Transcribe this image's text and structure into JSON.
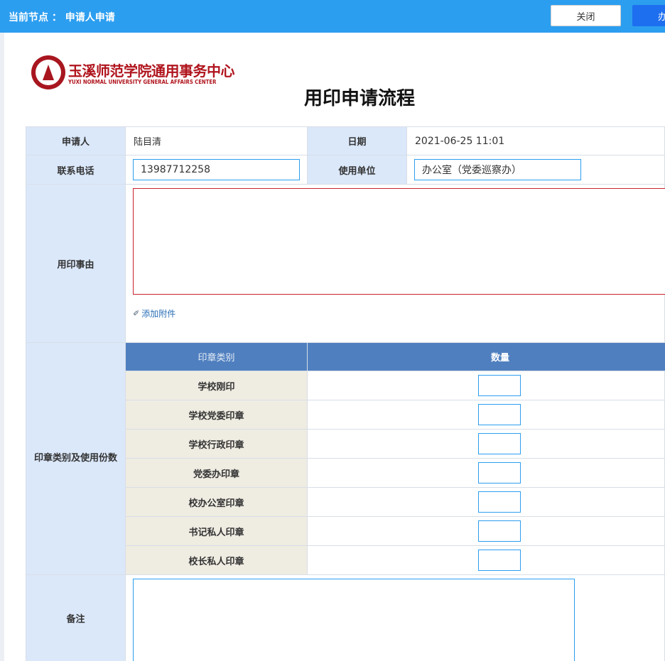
{
  "header": {
    "node_text": "当前节点 ： 申请人申请",
    "close_label": "关闭",
    "submit_label": "办理"
  },
  "logo": {
    "name_cn": "玉溪师范学院通用事务中心",
    "name_en": "YUXI NORMAL UNIVERSITY GENERAL  AFFAIRS CENTER"
  },
  "form": {
    "title": "用印申请流程",
    "applicant_label": "申请人",
    "applicant_value": "陆目清",
    "date_label": "日期",
    "date_value": "2021-06-25 11:01",
    "phone_label": "联系电话",
    "phone_value": "13987712258",
    "unit_label": "使用单位",
    "unit_value": "办公室（党委巡察办）",
    "reason_label": "用印事由",
    "reason_value": "",
    "attach_label": "添加附件",
    "seal_section_label": "印章类别及使用份数",
    "seal_col_type": "印章类别",
    "seal_col_qty": "数量",
    "seals": [
      {
        "name": "学校刚印",
        "qty": ""
      },
      {
        "name": "学校党委印章",
        "qty": ""
      },
      {
        "name": "学校行政印章",
        "qty": ""
      },
      {
        "name": "党委办印章",
        "qty": ""
      },
      {
        "name": "校办公室印章",
        "qty": ""
      },
      {
        "name": "书记私人印章",
        "qty": ""
      },
      {
        "name": "校长私人印章",
        "qty": ""
      }
    ],
    "remark_label": "备注",
    "remark_value": ""
  },
  "icons": {
    "attach": "paperclip-icon",
    "logo_seal": "university-seal-icon"
  },
  "colors": {
    "topbar": "#2c9ef0",
    "submit_button": "#1e6ff0",
    "label_bg": "#dbe8fa",
    "seal_header_bg": "#4f7fbf",
    "seal_name_bg": "#efece2",
    "reason_border": "#c8232c",
    "logo_red": "#b0141d"
  }
}
